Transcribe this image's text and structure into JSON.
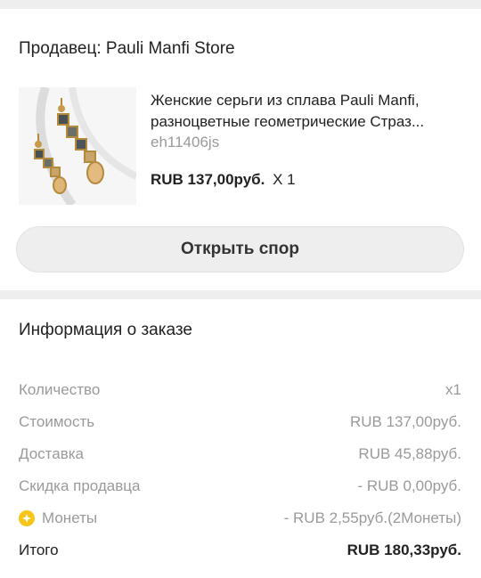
{
  "seller": {
    "title": "Продавец: Pauli Manfi Store"
  },
  "product": {
    "title_line1": "Женские серьги из сплава Pauli Manfi,",
    "title_line2": "разноцветные геометрические Страз...",
    "sku": "eh11406js",
    "price": "RUB 137,00руб.",
    "quantity": "X 1",
    "image_icon": "earrings-image"
  },
  "dispute_button": {
    "label": "Открыть спор"
  },
  "order_info": {
    "title": "Информация о заказе",
    "rows": [
      {
        "label": "Количество",
        "value": "x1"
      },
      {
        "label": "Стоимость",
        "value": "RUB 137,00руб."
      },
      {
        "label": "Доставка",
        "value": "RUB 45,88руб."
      },
      {
        "label": "Скидка продавца",
        "value": "- RUB 0,00руб."
      },
      {
        "label": "Монеты",
        "value": "- RUB 2,55руб.(2Монеты)",
        "icon": "coin-icon"
      }
    ],
    "total": {
      "label": "Итого",
      "value": "RUB 180,33руб."
    }
  },
  "colors": {
    "page_background": "#eeeeee",
    "card_background": "#ffffff",
    "muted_text": "#9a9a9a",
    "coin_yellow": "#f5c518"
  }
}
